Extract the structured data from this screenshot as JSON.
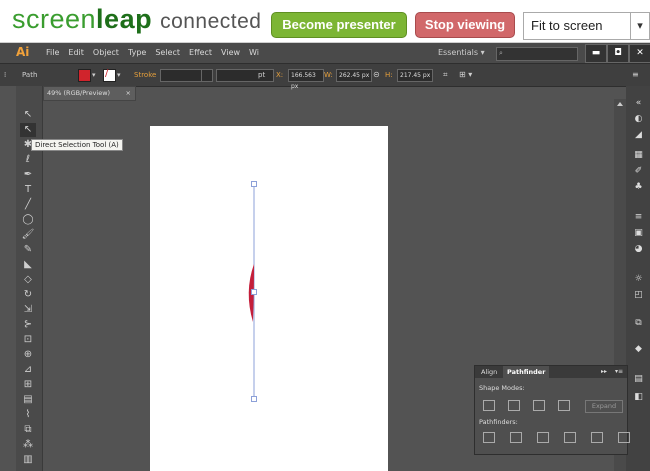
{
  "screenleap": {
    "logo_screen": "screen",
    "logo_leap": "leap",
    "logo_connected": "connected",
    "become_presenter": "Become presenter",
    "stop_viewing": "Stop viewing",
    "fit_select": "Fit to screen"
  },
  "app": {
    "logo": "Ai",
    "menus": [
      "File",
      "Edit",
      "Object",
      "Type",
      "Select",
      "Effect",
      "View",
      "Wi"
    ],
    "essentials": "Essentials ▾",
    "search_icon": "🔍",
    "window_buttons": [
      "▬",
      "◘",
      "✕"
    ]
  },
  "control_bar": {
    "path_label": "Path",
    "stroke_label": "Stroke",
    "stroke_unit": "pt",
    "x_label": "X:",
    "x_value": "166.563 px",
    "w_label": "W:",
    "w_value": "262.45 px",
    "h_label": "H:",
    "h_value": "217.45 px",
    "fill_color": "#d0242c"
  },
  "document": {
    "tab_label": "49% (RGB/Preview)",
    "tab_close": "×"
  },
  "tooltip": "Direct Selection Tool (A)",
  "pathfinder_panel": {
    "tab_align": "Align",
    "tab_pathfinder": "Pathfinder",
    "shape_modes_label": "Shape Modes:",
    "expand_button": "Expand",
    "pathfinders_label": "Pathfinders:"
  },
  "colors": {
    "shape_fill": "#c41e3a",
    "path_stroke": "#8ca0d8",
    "screenleap_green": "#7cb534",
    "screenleap_red": "#d1686a"
  }
}
